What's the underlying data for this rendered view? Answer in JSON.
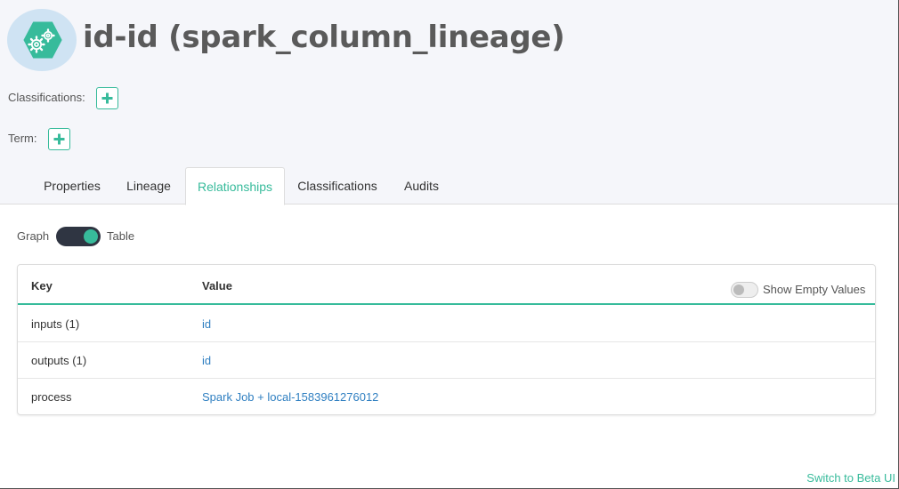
{
  "entity": {
    "title": "id-id (spark_column_lineage)",
    "icon": "gears-hexagon-icon",
    "icon_color": "#37bb9b",
    "icon_ring_color": "#cfe3f3"
  },
  "meta": {
    "classifications_label": "Classifications:",
    "term_label": "Term:"
  },
  "tabs": [
    {
      "label": "Properties",
      "active": false
    },
    {
      "label": "Lineage",
      "active": false
    },
    {
      "label": "Relationships",
      "active": true
    },
    {
      "label": "Classifications",
      "active": false
    },
    {
      "label": "Audits",
      "active": false
    }
  ],
  "view_toggle": {
    "left_label": "Graph",
    "right_label": "Table",
    "selected": "Table"
  },
  "table": {
    "key_header": "Key",
    "value_header": "Value",
    "show_empty_label": "Show Empty Values",
    "show_empty_on": false,
    "rows": [
      {
        "key": "inputs (1)",
        "value": "id"
      },
      {
        "key": "outputs (1)",
        "value": "id"
      },
      {
        "key": "process",
        "value": "Spark Job + local-1583961276012"
      }
    ]
  },
  "footer": {
    "beta_link": "Switch to Beta UI"
  },
  "colors": {
    "accent": "#37bb9b",
    "link": "#2f7fc1",
    "header_bg": "#f5f6fa"
  }
}
